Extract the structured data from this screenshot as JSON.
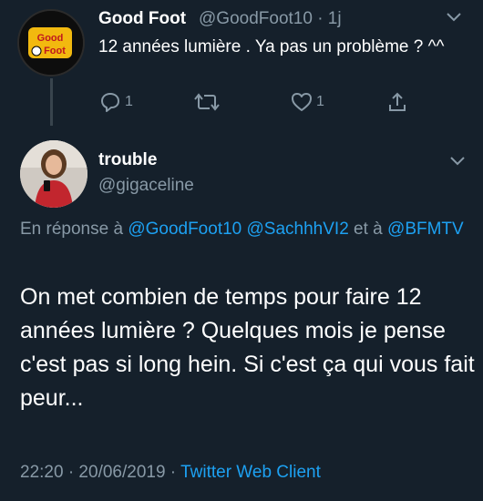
{
  "parent_tweet": {
    "avatar_logo_line1": "Good",
    "avatar_logo_line2": "Foot",
    "name": "Good Foot",
    "handle_time": "@GoodFoot10 · 1j",
    "text": "12 années lumière . Ya pas un problème ? ^^",
    "reply_count": "1",
    "retweet_count": "",
    "like_count": "1"
  },
  "main_tweet": {
    "name": "trouble",
    "handle": "@gigaceline",
    "reply_prefix": "En réponse à ",
    "reply_users": [
      "@GoodFoot10",
      "@SachhhVI2",
      "@BFMTV"
    ],
    "reply_joiner": " et à",
    "text": "On met combien de temps pour faire 12 années lumière ? Quelques mois je pense c'est pas si long hein. Si c'est ça qui vous fait peur...",
    "timestamp": "22:20 · 20/06/2019 · ",
    "client": "Twitter Web Client"
  },
  "colors": {
    "background": "#15202b",
    "text": "#ffffff",
    "secondary": "#8899a6",
    "link": "#1da1f2"
  },
  "icons": [
    "reply-icon",
    "retweet-icon",
    "like-icon",
    "share-icon",
    "chevron-down-icon"
  ]
}
